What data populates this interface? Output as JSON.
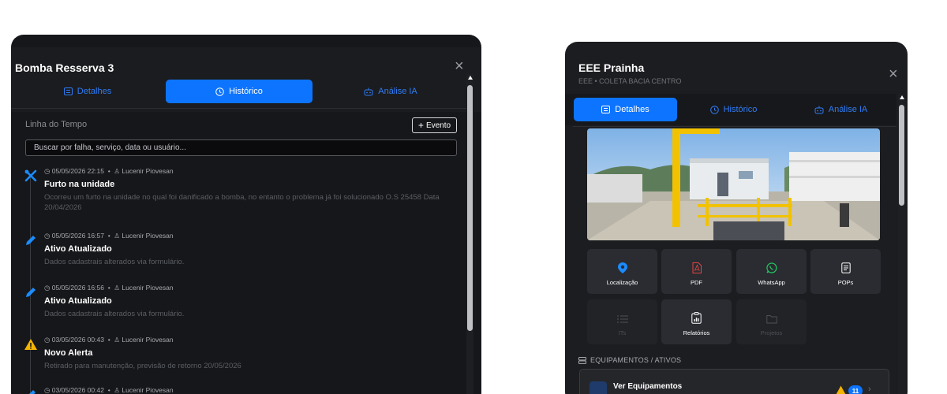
{
  "left_modal": {
    "title": "Bomba Resserva 3",
    "close": "×",
    "tabs": [
      {
        "label": "Detalhes",
        "icon": "list-icon",
        "active": false
      },
      {
        "label": "Histórico",
        "icon": "clock-icon",
        "active": true
      },
      {
        "label": "Análise IA",
        "icon": "robot-icon",
        "active": false
      }
    ],
    "section_title": "Linha do Tempo",
    "add_event_label": "Evento",
    "search_placeholder": "Buscar por falha, serviço, data ou usuário...",
    "events": [
      {
        "icon": "tools-icon",
        "datetime": "05/05/2026 22:15",
        "user": "Lucenir Piovesan",
        "title": "Furto na unidade",
        "description": "Ocorreu um furto na unidade no qual foi danificado a bomba, no entanto o problema já foi solucionado O.S 25458 Data 20/04/2026"
      },
      {
        "icon": "pencil-icon",
        "datetime": "05/05/2026 16:57",
        "user": "Lucenir Piovesan",
        "title": "Ativo Atualizado",
        "description": "Dados cadastrais alterados via formulário."
      },
      {
        "icon": "pencil-icon",
        "datetime": "05/05/2026 16:56",
        "user": "Lucenir Piovesan",
        "title": "Ativo Atualizado",
        "description": "Dados cadastrais alterados via formulário."
      },
      {
        "icon": "warning-icon",
        "datetime": "03/05/2026 00:43",
        "user": "Lucenir Piovesan",
        "title": "Novo Alerta",
        "description": "Retirado para manutenção, previsão de retorno 20/05/2026"
      },
      {
        "icon": "pencil-icon",
        "datetime": "03/05/2026 00:42",
        "user": "Lucenir Piovesan",
        "title": "",
        "description": ""
      }
    ]
  },
  "right_modal": {
    "title": "EEE Prainha",
    "subtitle": "EEE • COLETA BACIA CENTRO",
    "close": "×",
    "tabs": [
      {
        "label": "Detalhes",
        "icon": "list-icon",
        "active": true
      },
      {
        "label": "Histórico",
        "icon": "clock-icon",
        "active": false
      },
      {
        "label": "Análise IA",
        "icon": "robot-icon",
        "active": false
      }
    ],
    "actions": [
      {
        "label": "Localização",
        "icon": "map-pin-icon",
        "color": "#1b8cff",
        "enabled": true
      },
      {
        "label": "PDF",
        "icon": "pdf-icon",
        "color": "#e24545",
        "enabled": true
      },
      {
        "label": "WhatsApp",
        "icon": "whatsapp-icon",
        "color": "#22c55e",
        "enabled": true
      },
      {
        "label": "POPs",
        "icon": "document-icon",
        "color": "#ffffff",
        "enabled": true
      },
      {
        "label": "ITs",
        "icon": "checklist-icon",
        "color": "#4d5056",
        "enabled": false
      },
      {
        "label": "Relatórios",
        "icon": "report-icon",
        "color": "#ffffff",
        "enabled": true
      },
      {
        "label": "Projetos",
        "icon": "folder-icon",
        "color": "#4d5056",
        "enabled": false
      }
    ],
    "equipment_section": "EQUIPAMENTOS / ATIVOS",
    "equipment_button": "Ver Equipamentos",
    "equipment_count": "11"
  },
  "colors": {
    "accent": "#0d74ff",
    "panel": "#16171a",
    "warning": "#f5b400"
  }
}
